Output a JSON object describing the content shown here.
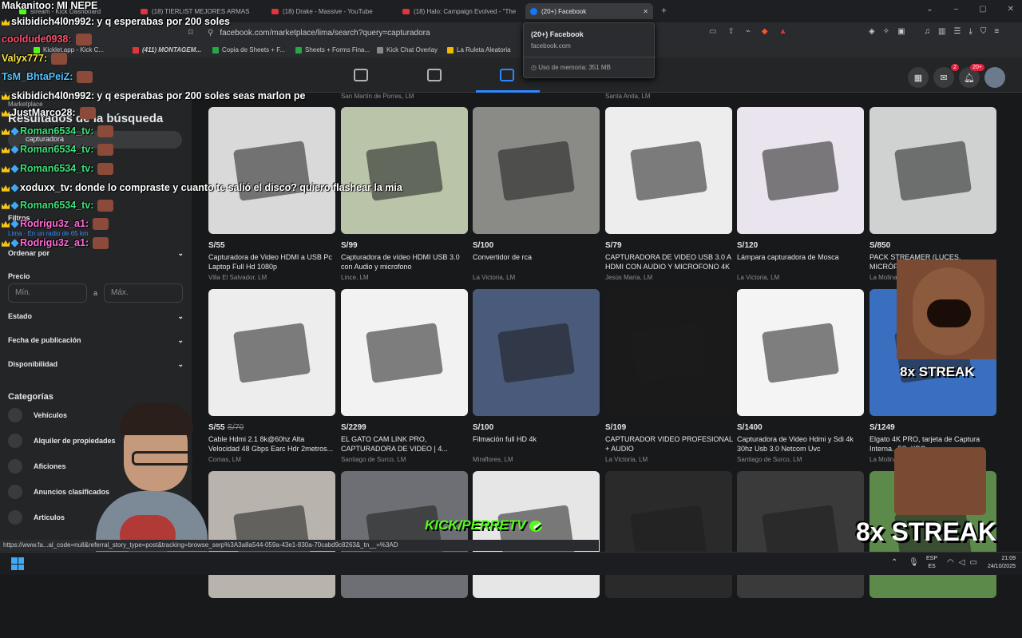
{
  "browser": {
    "tabs": [
      {
        "label": "stream - Kick Dashboard"
      },
      {
        "label": "(18) TIERLIST MEJORES ARMAS"
      },
      {
        "label": "(18) Drake - Massive - YouTube"
      },
      {
        "label": "(18) Halo: Campaign Evolved - \"The"
      },
      {
        "label": "(20+) Facebook"
      }
    ],
    "url": "facebook.com/marketplace/lima/search?query=capturadora",
    "bookmarks": [
      "Kicklet.app - Kick C...",
      "(411) MONTAGEM...",
      "Copia de Sheets + F...",
      "Sheets + Forms Fina...",
      "Kick Chat Overlay",
      "La Ruleta Aleatoria"
    ],
    "tooltip": {
      "title": "(20+) Facebook",
      "domain": "facebook.com",
      "memory": "Uso de memoria: 351 MB"
    },
    "status_url": "https://www.fa...al_code=null&referral_story_type=post&tracking=browse_serp%3A3a8a544-059a-43e1-830a-70cabd9c8263&_tn__=%3AD"
  },
  "fb": {
    "notif_badge": "20+",
    "msg_badge": "2"
  },
  "sidebar": {
    "section": "Marketplace",
    "results_title": "Resultados de la búsqueda",
    "search_value": "capturadora",
    "filters": "Filtros",
    "location": "Lima · En un radio de 65 km",
    "sort": "Ordenar por",
    "price": "Precio",
    "min": "Mín.",
    "to": "a",
    "max": "Máx.",
    "state": "Estado",
    "date": "Fecha de publicación",
    "availability": "Disponibilidad",
    "categories": "Categorías",
    "cats": [
      "Vehículos",
      "Alquiler de propiedades",
      "Aficiones",
      "Anuncios clasificados",
      "Artículos"
    ]
  },
  "row0_locs": [
    "San Martín de Porres, LM",
    "Santa Anita, LM"
  ],
  "listings": [
    {
      "price": "S/55",
      "old": "",
      "title": "Capturadora de Video HDMI a USB Pc Laptop Full Hd 1080p",
      "loc": "Villa El Salvador, LM",
      "color": "#d9d9d9"
    },
    {
      "price": "S/99",
      "old": "",
      "title": "Capturadora de vídeo HDMI USB 3.0 con Audio y microfono",
      "loc": "Lince, LM",
      "color": "#b9c4a8"
    },
    {
      "price": "S/100",
      "old": "",
      "title": "Convertidor de rca",
      "loc": "La Victoria, LM",
      "color": "#8a8a86"
    },
    {
      "price": "S/79",
      "old": "",
      "title": "CAPTURADORA DE VIDEO USB 3.0 A HDMI CON AUDIO Y MICROFONO 4K",
      "loc": "Jesús María, LM",
      "color": "#ededed"
    },
    {
      "price": "S/120",
      "old": "",
      "title": "Lámpara capturadora de Mosca",
      "loc": "La Victoria, LM",
      "color": "#eae4ee"
    },
    {
      "price": "S/850",
      "old": "",
      "title": "PACK STREAMER (LUCES, MICRÓFONO...",
      "loc": "La Molina, LM",
      "color": "#cfd2d0"
    },
    {
      "price": "S/55",
      "old": "S/70",
      "title": "Cable Hdmi 2.1 8k@60hz Alta Velocidad 48 Gbps Earc Hdr 2metros...",
      "loc": "Comas, LM",
      "color": "#ededed"
    },
    {
      "price": "S/2299",
      "old": "",
      "title": "EL GATO CAM LINK PRO, CAPTURADORA DE VIDEO | 4...",
      "loc": "Santiago de Surco, LM",
      "color": "#f2f2f2"
    },
    {
      "price": "S/100",
      "old": "",
      "title": "Filmación full HD 4k",
      "loc": "Miraflores, LM",
      "color": "#4a5a7a"
    },
    {
      "price": "S/109",
      "old": "",
      "title": "CAPTURADOR VIDEO PROFESIONAL + AUDIO",
      "loc": "La Victoria, LM",
      "color": "#1a1a1a"
    },
    {
      "price": "S/1400",
      "old": "",
      "title": "Capturadora de Video Hdmi y Sdi 4k 30hz Usb 3.0 Netcom Uvc",
      "loc": "Santiago de Surco, LM",
      "color": "#f4f4f4"
    },
    {
      "price": "S/1249",
      "old": "",
      "title": "Elgato 4K PRO, tarjeta de Captura Interna...5S, XBO...",
      "loc": "La Molina, LM",
      "color": "#3a6fc0"
    },
    {
      "price": "",
      "old": "",
      "title": "",
      "loc": "",
      "color": "#b8b3ad"
    },
    {
      "price": "",
      "old": "",
      "title": "",
      "loc": "",
      "color": "#6d6f74"
    },
    {
      "price": "",
      "old": "",
      "title": "",
      "loc": "",
      "color": "#e6e6e6"
    },
    {
      "price": "",
      "old": "",
      "title": "",
      "loc": "",
      "color": "#2a2a2a"
    },
    {
      "price": "",
      "old": "",
      "title": "",
      "loc": "",
      "color": "#3a3a3a"
    },
    {
      "price": "",
      "old": "",
      "title": "",
      "loc": "",
      "color": "#5b8a4a"
    }
  ],
  "chat": [
    {
      "user": "Makanitoo:",
      "msg": "MI NEPE",
      "color": "#ffffff"
    },
    {
      "user": "skibidich4l0n992:",
      "msg": "y q esperabas por 200 soles",
      "color": "#ffffff"
    },
    {
      "user": "cooldude0938:",
      "msg": "",
      "color": "#ff4d6a"
    },
    {
      "user": "Valyx777:",
      "msg": "",
      "color": "#f5e642"
    },
    {
      "user": "TsM_BhtaPeiZ:",
      "msg": "",
      "color": "#55c2ff"
    },
    {
      "user": "skibidich4l0n992:",
      "msg": "y q esperabas por 200 soles seas marlon pe",
      "color": "#ffffff"
    },
    {
      "user": "JustMarco28:",
      "msg": "",
      "color": "#ffffff"
    },
    {
      "user": "Roman6534_tv:",
      "msg": "",
      "color": "#3de07a"
    },
    {
      "user": "Roman6534_tv:",
      "msg": "",
      "color": "#3de07a"
    },
    {
      "user": "Roman6534_tv:",
      "msg": "",
      "color": "#3de07a"
    },
    {
      "user": "xoduxx_tv:",
      "msg": "donde lo compraste y cuanto te salió el disco? quiero flashear la mia",
      "color": "#ffffff"
    },
    {
      "user": "Roman6534_tv:",
      "msg": "",
      "color": "#3de07a"
    },
    {
      "user": "Rodrigu3z_a1:",
      "msg": "",
      "color": "#ff6ad5"
    },
    {
      "user": "Rodrigu3z_a1:",
      "msg": "",
      "color": "#ff6ad5"
    }
  ],
  "overlay": {
    "kick": "KICK/PERRETV",
    "streak1": "8x STREAK",
    "streak2": "8x STREAK"
  },
  "taskbar": {
    "lang1": "ESP",
    "lang2": "ES",
    "time": "21:09",
    "date": "24/10/2025"
  }
}
